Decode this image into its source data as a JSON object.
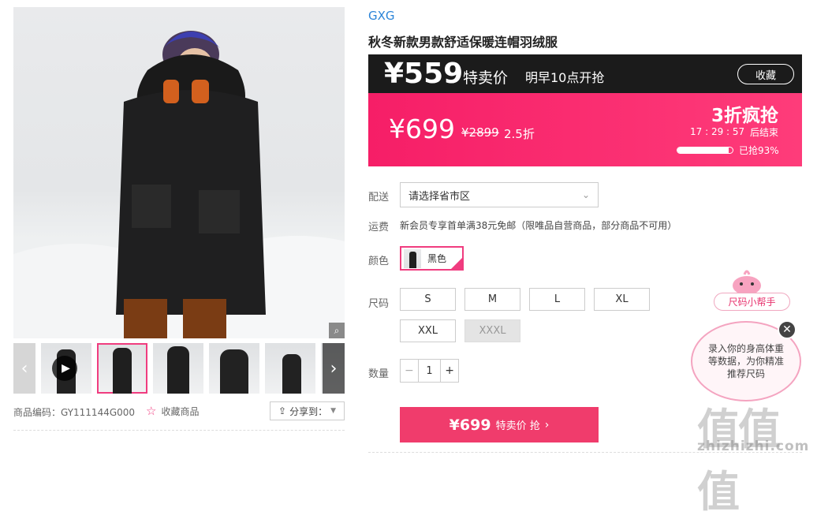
{
  "product": {
    "brand": "GXG",
    "title": "秋冬新款男款舒适保暖连帽羽绒服",
    "sku_code": "商品编码：GY111144G000",
    "favorite": "收藏商品",
    "share": "分享到："
  },
  "sale": {
    "special_price": "¥559",
    "special_label": "特卖价",
    "start_note": "明早10点开抢",
    "collect": "收藏",
    "price": "¥699",
    "orig_price": "¥2899",
    "discount": "2.5折",
    "promo": "3折疯抢",
    "countdown": "17 : 29 : 57",
    "countdown_suffix": "后结束",
    "sold_text": "已抢93%",
    "sold_fraction": 0.93
  },
  "form": {
    "delivery_label": "配送",
    "delivery_placeholder": "请选择省市区",
    "shipping_label": "运费",
    "shipping_text": "新会员专享首单满38元免邮（限唯品自营商品，部分商品不可用）",
    "color_label": "颜色",
    "color_value": "黑色",
    "size_label": "尺码",
    "sizes": [
      "S",
      "M",
      "L",
      "XL",
      "XXL",
      "XXXL"
    ],
    "qty_label": "数量",
    "qty_minus": "−",
    "qty_value": "1",
    "qty_plus": "+"
  },
  "buy": {
    "price": "¥699",
    "label": "特卖价 抢"
  },
  "helper": {
    "tag": "尺码小帮手",
    "text": "录入你的身高体重等数据，为你精准推荐尺码"
  },
  "watermark": {
    "text": "值值值",
    "url": "zhizhizhi.com"
  },
  "colors": {
    "pink": "#f61e67",
    "dark": "#1b1b1b",
    "blue": "#2b84d8"
  }
}
